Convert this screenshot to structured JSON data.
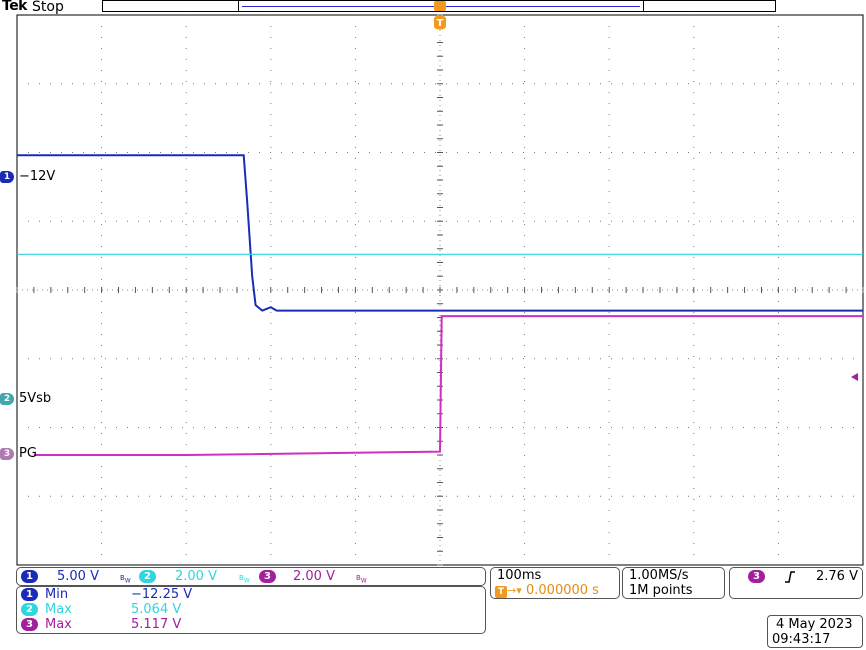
{
  "header": {
    "brand": "Tek",
    "status": "Stop",
    "trigger_marker": "T"
  },
  "channels": [
    {
      "id": "1",
      "marker_label": "1",
      "name": "−12V",
      "color": "#1a2bb8",
      "scale": "5.00 V"
    },
    {
      "id": "2",
      "marker_label": "2",
      "name": "5Vsb",
      "color": "#2fd6e0",
      "scale": "2.00 V"
    },
    {
      "id": "3",
      "marker_label": "3",
      "name": "PG",
      "color": "#d12ec4",
      "scale": "2.00 V"
    }
  ],
  "bw_icon": "bandwidth-limit-icon",
  "measurements": [
    {
      "channel": "1",
      "label": "Min",
      "value": "−12.25 V",
      "color": "#1a2bb8"
    },
    {
      "channel": "2",
      "label": "Max",
      "value": "5.064 V",
      "color": "#2fd6e0"
    },
    {
      "channel": "3",
      "label": "Max",
      "value": "5.117 V",
      "color": "#a3209d"
    }
  ],
  "timebase": {
    "scale": "100ms",
    "trigger_position": "0.000000 s",
    "trigger_icon": "T",
    "sample_rate": "1.00MS/s",
    "record_length": "1M points"
  },
  "trigger": {
    "source": "3",
    "slope_icon": "rising-edge-icon",
    "level": "2.76 V"
  },
  "datetime": {
    "date": "4 May 2023",
    "time": "09:43:17"
  },
  "chart_data": {
    "type": "line",
    "grid": true,
    "x": {
      "unit": "div",
      "range": [
        -5,
        5
      ]
    },
    "y": {
      "unit": "div",
      "range": [
        -4,
        4
      ]
    },
    "series": [
      {
        "name": "−12V",
        "color": "#1a2bb8",
        "points": [
          [
            -5,
            1.96
          ],
          [
            -2.32,
            1.96
          ],
          [
            -2.28,
            1.3
          ],
          [
            -2.22,
            0.2
          ],
          [
            -2.18,
            -0.22
          ],
          [
            -2.1,
            -0.3
          ],
          [
            -2.0,
            -0.25
          ],
          [
            -1.93,
            -0.3
          ],
          [
            5,
            -0.3
          ]
        ]
      },
      {
        "name": "5Vsb",
        "color": "#2fd6e0",
        "points": [
          [
            -5,
            0.52
          ],
          [
            5,
            0.52
          ]
        ]
      },
      {
        "name": "PG",
        "color": "#d12ec4",
        "points": [
          [
            -4.8,
            -2.4
          ],
          [
            -3.0,
            -2.4
          ],
          [
            0,
            -2.35
          ],
          [
            0.02,
            -0.38
          ],
          [
            5,
            -0.38
          ]
        ]
      }
    ]
  }
}
